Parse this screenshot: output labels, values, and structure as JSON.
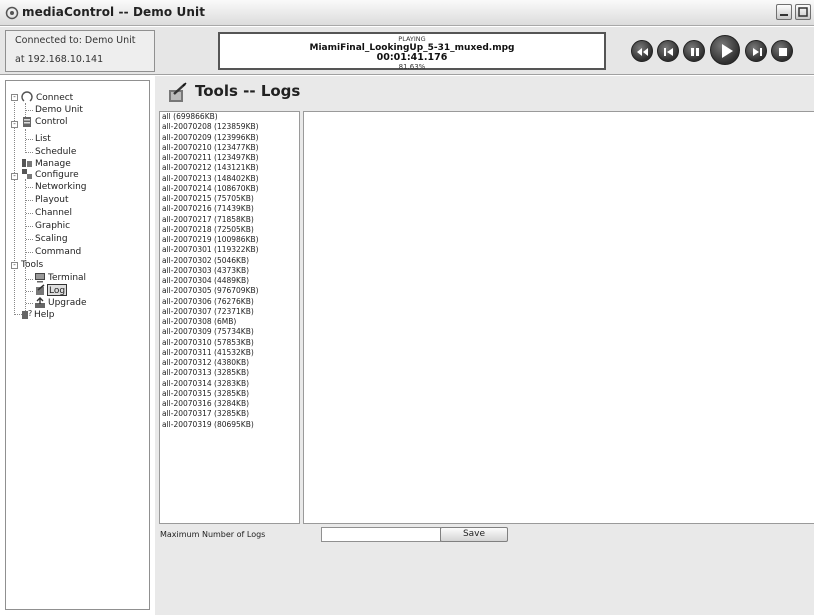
{
  "window": {
    "title": "mediaControl -- Demo Unit"
  },
  "connection": {
    "line1": "Connected to: Demo Unit",
    "line2": "at 192.168.10.141"
  },
  "now_playing": {
    "state": "PLAYING",
    "file": "MiamiFinal_LookingUp_5-31_muxed.mpg",
    "time": "00:01:41.176",
    "percent": "81.63%"
  },
  "transport": {
    "rewind": "rewind-icon",
    "previous": "skip-back-icon",
    "pause": "pause-icon",
    "play": "play-icon",
    "next": "skip-forward-icon",
    "stop": "stop-icon"
  },
  "nav": {
    "connect": "Connect",
    "demo_unit": "Demo Unit",
    "control": "Control",
    "list": "List",
    "schedule": "Schedule",
    "manage": "Manage",
    "configure": "Configure",
    "networking": "Networking",
    "playout": "Playout",
    "channel": "Channel",
    "graphic": "Graphic",
    "scaling": "Scaling",
    "command": "Command",
    "tools": "Tools",
    "terminal": "Terminal",
    "log": "Log",
    "upgrade": "Upgrade",
    "help": "Help"
  },
  "page": {
    "title": "Tools -- Logs"
  },
  "logs": [
    "all (699866KB)",
    "all-20070208 (123859KB)",
    "all-20070209 (123996KB)",
    "all-20070210 (123477KB)",
    "all-20070211 (123497KB)",
    "all-20070212 (143121KB)",
    "all-20070213 (148402KB)",
    "all-20070214 (108670KB)",
    "all-20070215 (75705KB)",
    "all-20070216 (71439KB)",
    "all-20070217 (71858KB)",
    "all-20070218 (72505KB)",
    "all-20070219 (100986KB)",
    "all-20070301 (119322KB)",
    "all-20070302 (5046KB)",
    "all-20070303 (4373KB)",
    "all-20070304 (4489KB)",
    "all-20070305 (976709KB)",
    "all-20070306 (76276KB)",
    "all-20070307 (72371KB)",
    "all-20070308 (6MB)",
    "all-20070309 (75734KB)",
    "all-20070310 (57853KB)",
    "all-20070311 (41532KB)",
    "all-20070312 (4380KB)",
    "all-20070313 (3285KB)",
    "all-20070314 (3283KB)",
    "all-20070315 (3285KB)",
    "all-20070316 (3284KB)",
    "all-20070317 (3285KB)",
    "all-20070319 (80695KB)"
  ],
  "settings": {
    "max_logs_label": "Maximum Number of Logs",
    "max_logs_value": "",
    "save_label": "Save"
  },
  "colors": {
    "title_bar": "#dcdcdc",
    "panel_bg": "#e9e9e9",
    "transport_button": "#3a3a3a"
  }
}
